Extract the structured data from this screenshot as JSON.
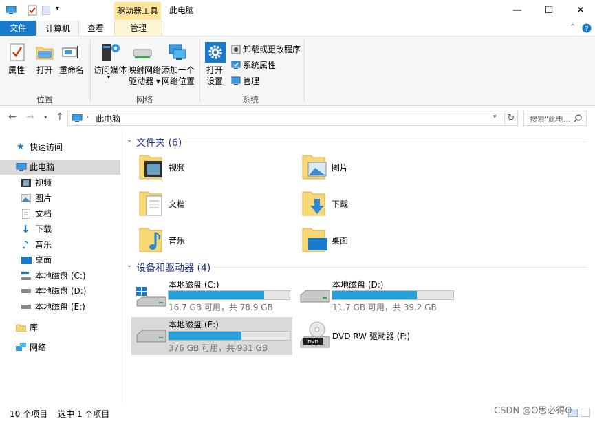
{
  "title_bar": {
    "context_tab": "驱动器工具",
    "window_title": "此电脑",
    "minimize": "—",
    "maximize": "☐",
    "close": "✕"
  },
  "ribbon_tabs": {
    "file": "文件",
    "computer": "计算机",
    "view": "查看",
    "manage": "管理"
  },
  "ribbon": {
    "properties": "属性",
    "open": "打开",
    "rename": "重命名",
    "group_location": "位置",
    "access_media": "访问媒体",
    "map_drive_1": "映射网络",
    "map_drive_2": "驱动器",
    "add_location_1": "添加一个",
    "add_location_2": "网络位置",
    "group_network": "网络",
    "open_settings_1": "打开",
    "open_settings_2": "设置",
    "uninstall": "卸载或更改程序",
    "system_properties": "系统属性",
    "manage": "管理",
    "group_system": "系统"
  },
  "address": {
    "path": "此电脑",
    "search_placeholder": "搜索\"此电..."
  },
  "nav": {
    "quick_access": "快速访问",
    "this_pc": "此电脑",
    "videos": "视频",
    "pictures": "图片",
    "documents": "文档",
    "downloads": "下载",
    "music": "音乐",
    "desktop": "桌面",
    "drive_c": "本地磁盘 (C:)",
    "drive_d": "本地磁盘 (D:)",
    "drive_e": "本地磁盘 (E:)",
    "libraries": "库",
    "network": "网络"
  },
  "folders_section": "文件夹 (6)",
  "folders": {
    "videos": "视频",
    "pictures": "图片",
    "documents": "文档",
    "downloads": "下载",
    "music": "音乐",
    "desktop": "桌面"
  },
  "devices_section": "设备和驱动器 (4)",
  "drives": {
    "c": {
      "name": "本地磁盘 (C:)",
      "free": "16.7 GB 可用，共 78.9 GB",
      "used_fraction": 0.79
    },
    "d": {
      "name": "本地磁盘 (D:)",
      "free": "11.7 GB 可用，共 39.2 GB",
      "used_fraction": 0.7
    },
    "e": {
      "name": "本地磁盘 (E:)",
      "free": "376 GB 可用，共 931 GB",
      "used_fraction": 0.6
    },
    "f": {
      "name": "DVD RW 驱动器 (F:)"
    }
  },
  "status": {
    "item_count": "10 个项目",
    "selected": "选中 1 个项目"
  },
  "watermark": "CSDN @O思必得O"
}
